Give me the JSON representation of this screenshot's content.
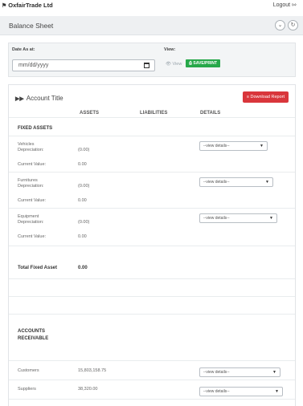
{
  "topbar": {
    "brand": "OxfairTrade Ltd",
    "logout": "Logout"
  },
  "page": {
    "title": "Balance Sheet"
  },
  "filter": {
    "date_label": "Date As at:",
    "date_placeholder": "mm/dd/yyyy",
    "view_label": "View:",
    "view_link": "View",
    "save_print": "SAVE/PRINT"
  },
  "report": {
    "account_title": "Account Title",
    "download": "Download Report",
    "columns": {
      "assets": "ASSETS",
      "liabilities": "LIABILITIES",
      "details": "DETAILS"
    },
    "fixed_assets": {
      "heading": "FIXED ASSETS",
      "items": [
        {
          "name": "Vehicles",
          "depreciation_label": "Depreciation:",
          "depreciation": "(0.00)",
          "current_label": "Current Value:",
          "current": "0.00",
          "details": "--view details--"
        },
        {
          "name": "Furnitures",
          "depreciation_label": "Depreciation:",
          "depreciation": "(0.00)",
          "current_label": "Current Value:",
          "current": "0.00",
          "details": "--view details--"
        },
        {
          "name": "Equipment",
          "depreciation_label": "Depreciation:",
          "depreciation": "(0.00)",
          "current_label": "Current Value:",
          "current": "0.00",
          "details": "--view details--"
        }
      ],
      "total_label": "Total Fixed Asset",
      "total_value": "0.00"
    },
    "receivable": {
      "heading_line1": "ACCOUNTS",
      "heading_line2": "RECEIVABLE",
      "items": [
        {
          "name": "Customers",
          "value": "15,803,158.75",
          "details": "--view details--"
        },
        {
          "name": "Suppliers",
          "value": "38,320.00",
          "details": "--view details--"
        }
      ]
    }
  }
}
